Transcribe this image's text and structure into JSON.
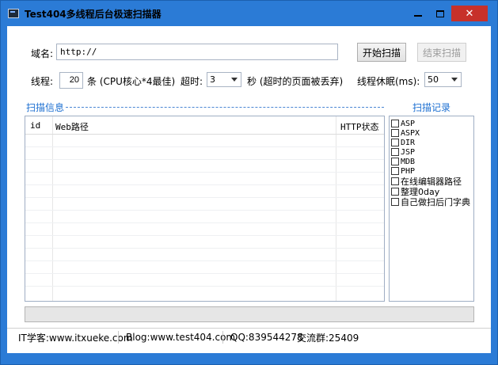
{
  "window": {
    "title": "Test404多线程后台极速扫描器",
    "close_glyph": "✕"
  },
  "form": {
    "domain_label": "域名:",
    "domain_value": "http://",
    "start_button": "开始扫描",
    "stop_button": "结束扫描",
    "threads_label": "线程:",
    "threads_value": "20",
    "threads_unit": "条 (CPU核心*4最佳)",
    "timeout_label": "超时:",
    "timeout_value": "3",
    "timeout_unit": "秒 (超时的页面被丢弃)",
    "sleep_label": "线程休眠(ms):",
    "sleep_value": "50"
  },
  "scan_info": {
    "caption": "扫描信息",
    "columns": [
      "id",
      "Web路径",
      "HTTP状态"
    ]
  },
  "scan_records": {
    "caption": "扫描记录",
    "items": [
      "ASP",
      "ASPX",
      "DIR",
      "JSP",
      "MDB",
      "PHP",
      "在线编辑器路径",
      "整理0day",
      "自己做扫后门字典"
    ]
  },
  "statusbar": {
    "itxueke": "IT学客:www.itxueke.com",
    "blog": "Blog:www.test404.com",
    "qq": "QQ:839544278",
    "group": "交流群:25409"
  },
  "icons": {
    "app": "app-icon",
    "minimize": "minimize-icon",
    "maximize": "maximize-icon",
    "close": "close-icon",
    "dropdown": "chevron-down-icon"
  },
  "colors": {
    "titlebar": "#2b7bd6",
    "close": "#c7312a",
    "caption": "#1c6fd1"
  }
}
